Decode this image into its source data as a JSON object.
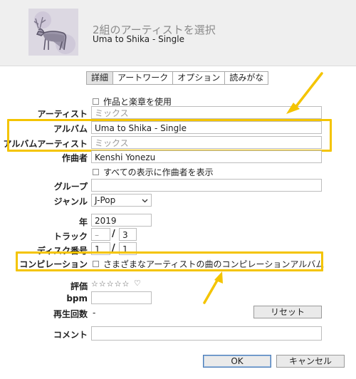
{
  "header": {
    "title": "2組のアーティストを選択",
    "subtitle": "Uma to Shika - Single"
  },
  "tabs": [
    {
      "label": "詳細",
      "active": true
    },
    {
      "label": "アートワーク",
      "active": false
    },
    {
      "label": "オプション",
      "active": false
    },
    {
      "label": "読みがな",
      "active": false
    }
  ],
  "form": {
    "use_work_checkbox": "作品と楽章を使用",
    "artist": {
      "label": "アーティスト",
      "value": "ミックス"
    },
    "album": {
      "label": "アルバム",
      "value": "Uma to Shika - Single"
    },
    "album_artist": {
      "label": "アルバムアーティスト",
      "value": "ミックス"
    },
    "composer": {
      "label": "作曲者",
      "value": "Kenshi Yonezu"
    },
    "show_composer_checkbox": "すべての表示に作曲者を表示",
    "grouping": {
      "label": "グループ",
      "value": ""
    },
    "genre": {
      "label": "ジャンル",
      "value": "J-Pop"
    },
    "year": {
      "label": "年",
      "value": "2019"
    },
    "track": {
      "label": "トラック",
      "number": "–",
      "total": "3"
    },
    "disc": {
      "label": "ディスク番号",
      "number": "1",
      "total": "1"
    },
    "compilation": {
      "label": "コンピレーション",
      "checkbox": "さまざまなアーティストの曲のコンピレーションアルバム"
    },
    "rating": {
      "label": "評価",
      "stars": "☆☆☆☆☆",
      "heart": "♡"
    },
    "bpm": {
      "label": "bpm",
      "value": ""
    },
    "play_count": {
      "label": "再生回数",
      "value": "-",
      "reset_label": "リセット"
    },
    "comment": {
      "label": "コメント",
      "value": ""
    }
  },
  "footer": {
    "ok_label": "OK",
    "cancel_label": "キャンセル"
  },
  "colors": {
    "highlight": "#f4c400",
    "arrow": "#f4c400"
  }
}
